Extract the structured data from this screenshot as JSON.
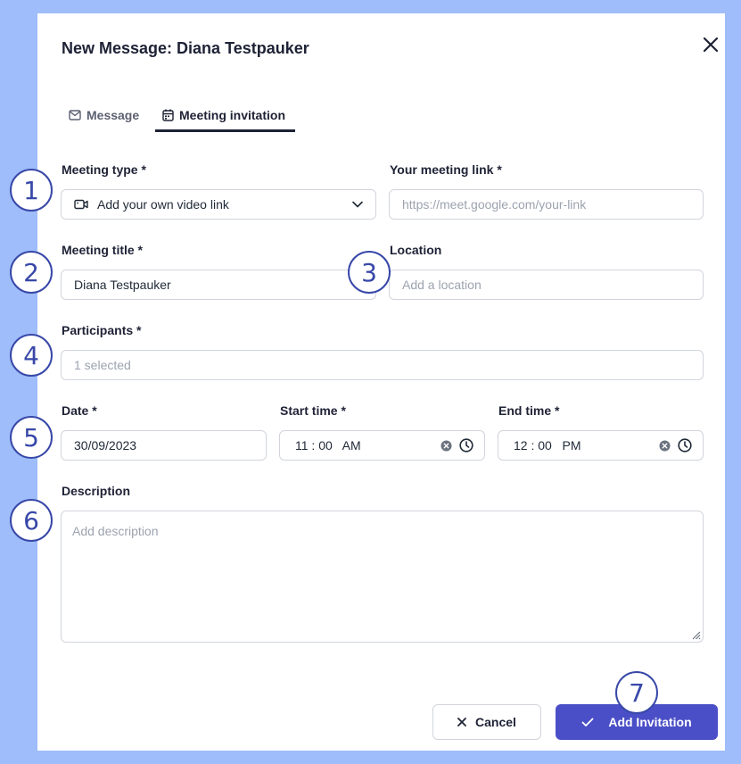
{
  "dialog": {
    "title": "New Message: Diana Testpauker"
  },
  "tabs": [
    {
      "label": "Message",
      "icon": "mail-icon"
    },
    {
      "label": "Meeting invitation",
      "icon": "calendar-icon"
    }
  ],
  "form": {
    "meeting_type": {
      "label": "Meeting type *",
      "value": "Add your own video link",
      "icon": "video-icon"
    },
    "meeting_link": {
      "label": "Your meeting link *",
      "placeholder": "https://meet.google.com/your-link"
    },
    "meeting_title": {
      "label": "Meeting title *",
      "value": "Diana Testpauker"
    },
    "location": {
      "label": "Location",
      "placeholder": "Add a location"
    },
    "participants": {
      "label": "Participants *",
      "placeholder": "1 selected"
    },
    "date": {
      "label": "Date *",
      "value": "30/09/2023"
    },
    "start_time": {
      "label": "Start time *",
      "value": "11 : 00   AM"
    },
    "end_time": {
      "label": "End time *",
      "value": "12 : 00   PM"
    },
    "description": {
      "label": "Description",
      "placeholder": "Add description"
    }
  },
  "buttons": {
    "cancel": "Cancel",
    "add": "Add Invitation"
  },
  "annotations": [
    "1",
    "2",
    "3",
    "4",
    "5",
    "6",
    "7"
  ],
  "colors": {
    "backdrop": "#9ebdfa",
    "primary": "#4b4fc7",
    "annotation": "#3848a8"
  }
}
